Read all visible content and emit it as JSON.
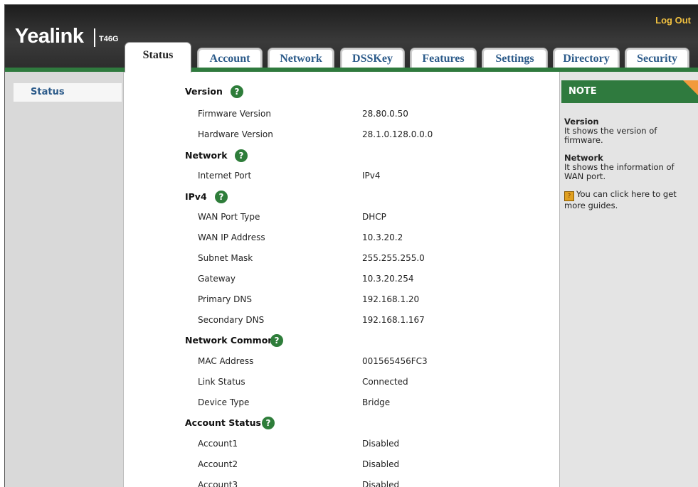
{
  "brand": {
    "logo": "Yealink",
    "model": "T46G"
  },
  "header": {
    "logout": "Log Out"
  },
  "tabs": [
    {
      "label": "Status"
    },
    {
      "label": "Account"
    },
    {
      "label": "Network"
    },
    {
      "label": "DSSKey"
    },
    {
      "label": "Features"
    },
    {
      "label": "Settings"
    },
    {
      "label": "Directory"
    },
    {
      "label": "Security"
    }
  ],
  "sidebar": {
    "items": [
      {
        "label": "Status"
      }
    ]
  },
  "sections": {
    "version": {
      "title": "Version",
      "rows": [
        {
          "label": "Firmware Version",
          "value": "28.80.0.50"
        },
        {
          "label": "Hardware Version",
          "value": "28.1.0.128.0.0.0"
        }
      ]
    },
    "network": {
      "title": "Network",
      "rows": [
        {
          "label": "Internet Port",
          "value": "IPv4"
        }
      ]
    },
    "ipv4": {
      "title": "IPv4",
      "rows": [
        {
          "label": "WAN Port Type",
          "value": "DHCP"
        },
        {
          "label": "WAN IP Address",
          "value": "10.3.20.2"
        },
        {
          "label": "Subnet Mask",
          "value": "255.255.255.0"
        },
        {
          "label": "Gateway",
          "value": "10.3.20.254"
        },
        {
          "label": "Primary DNS",
          "value": "192.168.1.20"
        },
        {
          "label": "Secondary DNS",
          "value": "192.168.1.167"
        }
      ]
    },
    "network_common": {
      "title": "Network Common",
      "rows": [
        {
          "label": "MAC Address",
          "value": "001565456FC3"
        },
        {
          "label": "Link Status",
          "value": "Connected"
        },
        {
          "label": "Device Type",
          "value": "Bridge"
        }
      ]
    },
    "account_status": {
      "title": "Account Status",
      "rows": [
        {
          "label": "Account1",
          "value": "Disabled"
        },
        {
          "label": "Account2",
          "value": "Disabled"
        },
        {
          "label": "Account3",
          "value": "Disabled"
        }
      ]
    }
  },
  "help_glyph": "?",
  "note": {
    "heading": "NOTE",
    "version_title": "Version",
    "version_text": "It shows the version of firmware.",
    "network_title": "Network",
    "network_text": "It shows the information of WAN port.",
    "guide_text": "You can click here to get more guides."
  },
  "colors": {
    "accent_green": "#2f7a3e",
    "tab_text": "#2c5b8a",
    "corner_orange": "#f29a3c",
    "logout_yellow": "#f0c040"
  }
}
